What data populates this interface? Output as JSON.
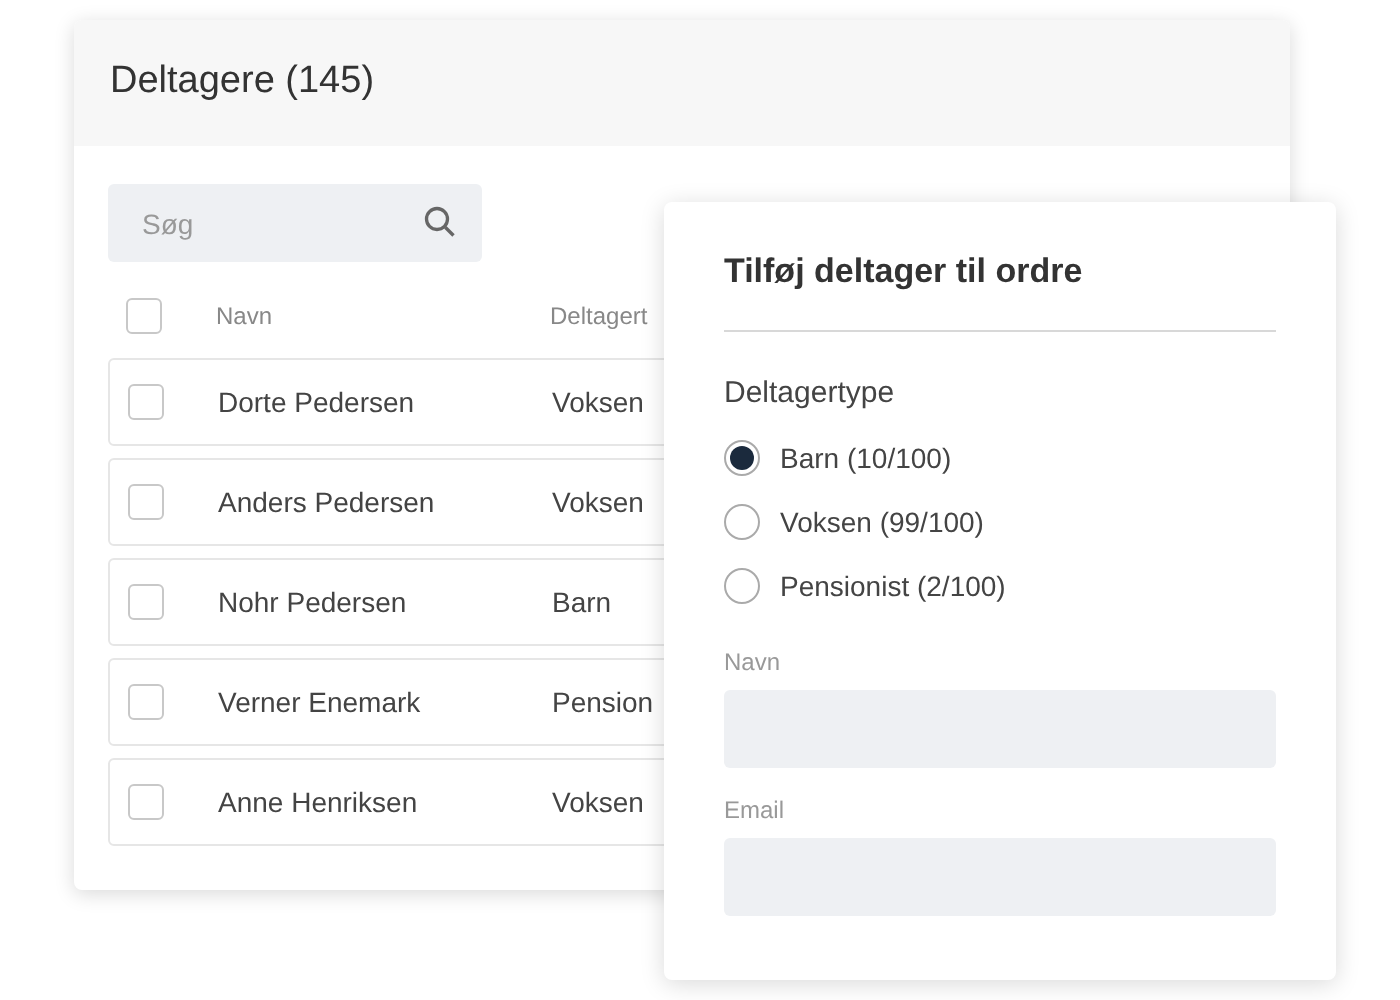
{
  "card": {
    "title": "Deltagere (145)",
    "search": {
      "placeholder": "Søg"
    },
    "table": {
      "select_all": {
        "checked": false
      },
      "columns": [
        "Navn",
        "Deltagert"
      ],
      "rows": [
        {
          "checked": false,
          "cells": [
            "Dorte Pedersen",
            "Voksen"
          ]
        },
        {
          "checked": false,
          "cells": [
            "Anders Pedersen",
            "Voksen"
          ]
        },
        {
          "checked": false,
          "cells": [
            "Nohr Pedersen",
            "Barn"
          ]
        },
        {
          "checked": false,
          "cells": [
            "Verner Enemark",
            "Pension"
          ]
        },
        {
          "checked": false,
          "cells": [
            "Anne Henriksen",
            "Voksen"
          ]
        }
      ]
    }
  },
  "dialog": {
    "title": "Tilføj deltager til ordre",
    "group_label": "Deltagertype",
    "options": [
      {
        "label": "Barn (10/100)",
        "selected": true
      },
      {
        "label": "Voksen (99/100)",
        "selected": false
      },
      {
        "label": "Pensionist (2/100)",
        "selected": false
      }
    ],
    "fields": [
      {
        "label": "Navn"
      },
      {
        "label": "Email"
      }
    ]
  }
}
